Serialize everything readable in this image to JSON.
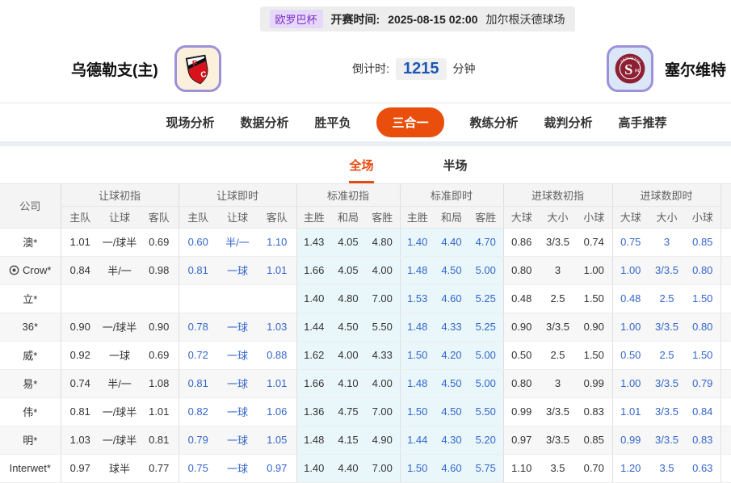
{
  "top_bar": {
    "league": "欧罗巴杯",
    "kickoff_label": "开赛时间:",
    "kickoff_time": "2025-08-15 02:00",
    "venue": "加尔根沃德球场"
  },
  "teams": {
    "home": {
      "name": "乌德勒支(主)"
    },
    "away": {
      "name": "塞尔维特"
    }
  },
  "countdown": {
    "label": "倒计时:",
    "value": "1215",
    "unit": "分钟"
  },
  "nav": {
    "tabs": [
      {
        "label": "现场分析",
        "active": false
      },
      {
        "label": "数据分析",
        "active": false
      },
      {
        "label": "胜平负",
        "active": false
      },
      {
        "label": "三合一",
        "active": true
      },
      {
        "label": "教练分析",
        "active": false
      },
      {
        "label": "裁判分析",
        "active": false
      },
      {
        "label": "高手推荐",
        "active": false
      }
    ]
  },
  "subtabs": [
    {
      "label": "全场",
      "active": true
    },
    {
      "label": "半场",
      "active": false
    }
  ],
  "table": {
    "company_header": "公司",
    "groups": [
      {
        "label": "让球初指",
        "cols": [
          "主队",
          "让球",
          "客队"
        ]
      },
      {
        "label": "让球即时",
        "cols": [
          "主队",
          "让球",
          "客队"
        ]
      },
      {
        "label": "标准初指",
        "cols": [
          "主胜",
          "和局",
          "客胜"
        ]
      },
      {
        "label": "标准即时",
        "cols": [
          "主胜",
          "和局",
          "客胜"
        ]
      },
      {
        "label": "进球数初指",
        "cols": [
          "大球",
          "大小",
          "小球"
        ]
      },
      {
        "label": "进球数即时",
        "cols": [
          "大球",
          "大小",
          "小球"
        ]
      }
    ],
    "rows": [
      {
        "company": "澳*",
        "has_icon": false,
        "cells": [
          "1.01",
          "一/球半",
          "0.69",
          "0.60",
          "半/一",
          "1.10",
          "1.43",
          "4.05",
          "4.80",
          "1.40",
          "4.40",
          "4.70",
          "0.86",
          "3/3.5",
          "0.74",
          "0.75",
          "3",
          "0.85"
        ]
      },
      {
        "company": "Crow*",
        "has_icon": true,
        "cells": [
          "0.84",
          "半/一",
          "0.98",
          "0.81",
          "一球",
          "1.01",
          "1.66",
          "4.05",
          "4.00",
          "1.48",
          "4.50",
          "5.00",
          "0.80",
          "3",
          "1.00",
          "1.00",
          "3/3.5",
          "0.80"
        ]
      },
      {
        "company": "立*",
        "has_icon": false,
        "cells": [
          "",
          "",
          "",
          "",
          "",
          "",
          "1.40",
          "4.80",
          "7.00",
          "1.53",
          "4.60",
          "5.25",
          "0.48",
          "2.5",
          "1.50",
          "0.48",
          "2.5",
          "1.50"
        ]
      },
      {
        "company": "36*",
        "has_icon": false,
        "cells": [
          "0.90",
          "一/球半",
          "0.90",
          "0.78",
          "一球",
          "1.03",
          "1.44",
          "4.50",
          "5.50",
          "1.48",
          "4.33",
          "5.25",
          "0.90",
          "3/3.5",
          "0.90",
          "1.00",
          "3/3.5",
          "0.80"
        ]
      },
      {
        "company": "威*",
        "has_icon": false,
        "cells": [
          "0.92",
          "一球",
          "0.69",
          "0.72",
          "一球",
          "0.88",
          "1.62",
          "4.00",
          "4.33",
          "1.50",
          "4.20",
          "5.00",
          "0.50",
          "2.5",
          "1.50",
          "0.50",
          "2.5",
          "1.50"
        ]
      },
      {
        "company": "易*",
        "has_icon": false,
        "cells": [
          "0.74",
          "半/一",
          "1.08",
          "0.81",
          "一球",
          "1.01",
          "1.66",
          "4.10",
          "4.00",
          "1.48",
          "4.50",
          "5.00",
          "0.80",
          "3",
          "0.99",
          "1.00",
          "3/3.5",
          "0.79"
        ]
      },
      {
        "company": "伟*",
        "has_icon": false,
        "cells": [
          "0.81",
          "一/球半",
          "1.01",
          "0.82",
          "一球",
          "1.06",
          "1.36",
          "4.75",
          "7.00",
          "1.50",
          "4.50",
          "5.50",
          "0.99",
          "3/3.5",
          "0.83",
          "1.01",
          "3/3.5",
          "0.84"
        ]
      },
      {
        "company": "明*",
        "has_icon": false,
        "cells": [
          "1.03",
          "一/球半",
          "0.81",
          "0.79",
          "一球",
          "1.05",
          "1.48",
          "4.15",
          "4.90",
          "1.44",
          "4.30",
          "5.20",
          "0.97",
          "3/3.5",
          "0.85",
          "0.99",
          "3/3.5",
          "0.83"
        ]
      },
      {
        "company": "Interwet*",
        "has_icon": false,
        "cells": [
          "0.97",
          "球半",
          "0.77",
          "0.75",
          "一球",
          "0.97",
          "1.40",
          "4.40",
          "7.00",
          "1.50",
          "4.60",
          "5.75",
          "1.10",
          "3.5",
          "0.70",
          "1.20",
          "3.5",
          "0.63"
        ]
      }
    ]
  },
  "colors": {
    "accent_orange": "#e94e0d",
    "subtab_red": "#e8490f",
    "odds_blue": "#3366cc",
    "standard_col_bg": "#eaf7fa",
    "league_badge_bg": "#e6d8f8",
    "league_badge_text": "#7b2fc9",
    "countdown_blue": "#1d57b5"
  }
}
